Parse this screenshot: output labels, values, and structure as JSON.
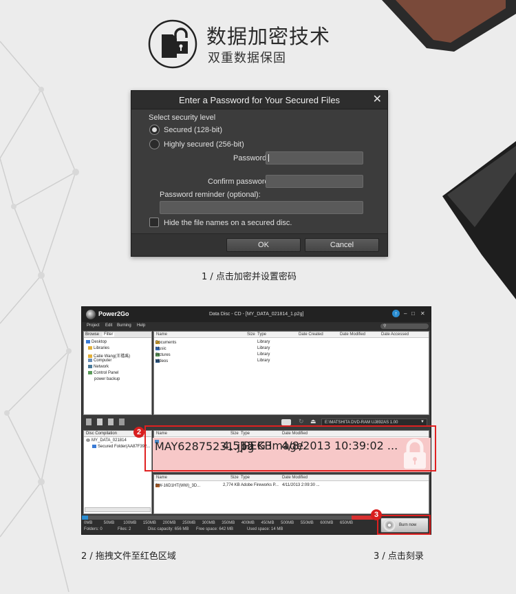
{
  "header": {
    "title": "数据加密技术",
    "subtitle": "双重数据保固"
  },
  "dialog": {
    "title": "Enter a Password for Your Secured Files",
    "security_level_label": "Select security level",
    "option_secured": "Secured (128-bit)",
    "option_highly_secured": "Highly secured (256-bit)",
    "selected_option": "Secured (128-bit)",
    "password_label": "Password:",
    "password_value": "",
    "confirm_label": "Confirm password:",
    "confirm_value": "",
    "reminder_label": "Password reminder (optional):",
    "reminder_value": "",
    "hide_names_label": "Hide the file names on a secured disc.",
    "hide_names_checked": false,
    "ok_label": "OK",
    "cancel_label": "Cancel"
  },
  "captions": {
    "step1": "1 / 点击加密并设置密码",
    "step2": "2 / 拖拽文件至红色区域",
    "step3": "3 / 点击刻录"
  },
  "power2go": {
    "app_name": "Power2Go",
    "window_title": "Data Disc - CD - [MY_DATA_021814_1.p2g]",
    "menu": [
      "Project",
      "Edit",
      "Burning",
      "Help"
    ],
    "browse_tabs": [
      "Browse",
      "Filter"
    ],
    "tree": [
      "Desktop",
      "Libraries",
      "Catie Wang(王禧禹)",
      "Computer",
      "Network",
      "Control Panel",
      "power backup"
    ],
    "browser_columns": [
      "Name",
      "Size",
      "Type",
      "Date Created",
      "Date Modified",
      "Date Accessed"
    ],
    "browser_rows": [
      {
        "name": "Documents",
        "type": "Library"
      },
      {
        "name": "Music",
        "type": "Library"
      },
      {
        "name": "Pictures",
        "type": "Library"
      },
      {
        "name": "Videos",
        "type": "Library"
      }
    ],
    "drive": "E:\\MATSHITA DVD-RAM UJ892AS 1.00",
    "disc_compilation_label": "Disc Compilation",
    "disc_tree": [
      "MY_DATA_021814",
      "Secured Folder(AA87F392..."
    ],
    "disc_columns": [
      "Name",
      "Size",
      "Type",
      "Date Modified"
    ],
    "secured_rows": [
      {
        "name": "MAY62875231.jpg",
        "size": "4,512 KB",
        "type": "JPEG image",
        "modified": "4/8/2013 10:39:02 ..."
      }
    ],
    "normal_rows": [
      {
        "name": "BW-16D1HT(WW)_3D...",
        "size": "2,774 KB",
        "type": "Adobe Fireworks P...",
        "modified": "4/11/2013 2:09:30 ..."
      }
    ],
    "scale_labels": [
      "0MB",
      "50MB",
      "100MB",
      "150MB",
      "200MB",
      "250MB",
      "300MB",
      "350MB",
      "400MB",
      "450MB",
      "500MB",
      "550MB",
      "600MB",
      "650MB"
    ],
    "used_fraction": 0.02,
    "status": {
      "folders": "Folders: 0",
      "files": "Files: 2",
      "capacity": "Disc capacity: 656 MB",
      "free": "Free space: 642 MB",
      "used": "Used space: 14 MB"
    },
    "burn_label": "Burn now",
    "badge2": "2",
    "badge3": "3"
  },
  "colors": {
    "accent_red": "#e02020",
    "drop_zone": "#f7c8c8",
    "dialog_bg": "#3c3c3c"
  }
}
